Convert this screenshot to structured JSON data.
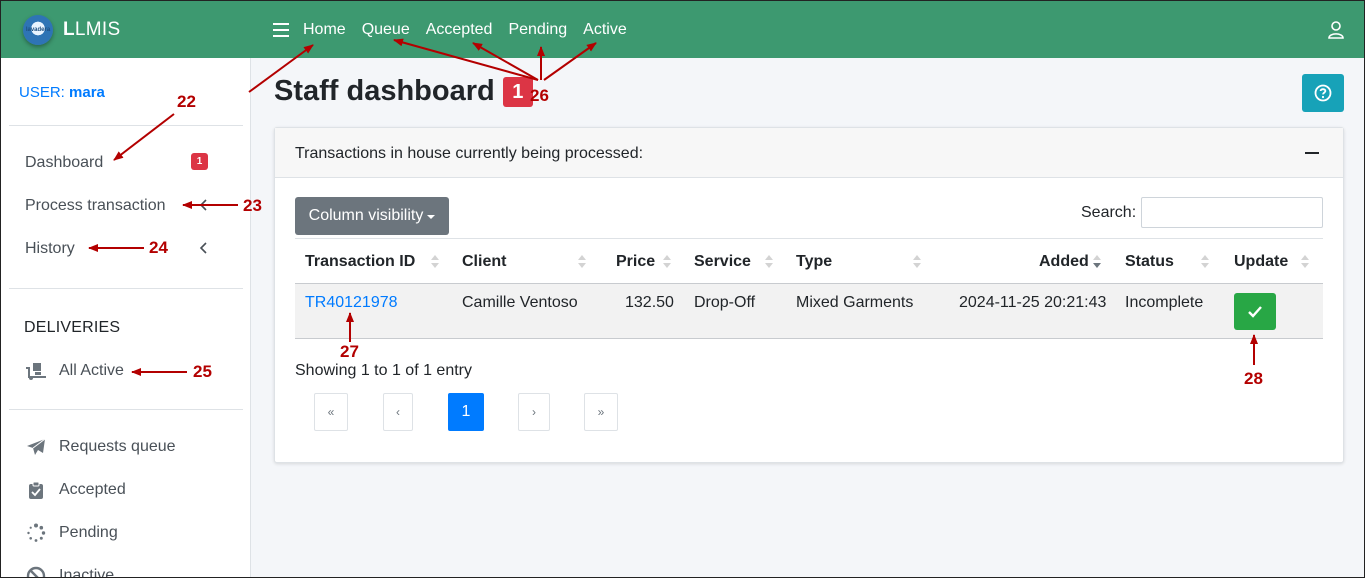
{
  "app": {
    "brand_rest": "LMIS",
    "brand_first": "L",
    "logo_text": "lavadera"
  },
  "topnav": {
    "links": [
      "Home",
      "Queue",
      "Accepted",
      "Pending",
      "Active"
    ]
  },
  "sidebar": {
    "user_label": "USER:",
    "user_name": "mara",
    "items": [
      {
        "label": "Dashboard",
        "badge": "1"
      },
      {
        "label": "Process transaction"
      },
      {
        "label": "History"
      }
    ],
    "deliveries_header": "DELIVERIES",
    "delivery_items": [
      {
        "label": "All Active",
        "icon": "truck-loading-icon"
      }
    ],
    "queue_items": [
      {
        "label": "Requests queue",
        "icon": "paper-plane-icon"
      },
      {
        "label": "Accepted",
        "icon": "clipboard-check-icon"
      },
      {
        "label": "Pending",
        "icon": "spinner-icon"
      },
      {
        "label": "Inactive",
        "icon": "ban-icon"
      }
    ]
  },
  "main": {
    "title": "Staff dashboard",
    "title_badge": "1",
    "card_title": "Transactions in house currently being processed:",
    "column_visibility": "Column visibility",
    "search_label": "Search:",
    "search_value": "",
    "columns": [
      "Transaction ID",
      "Client",
      "Price",
      "Service",
      "Type",
      "Added",
      "Status",
      "Update"
    ],
    "rows": [
      {
        "transaction_id": "TR40121978",
        "client": "Camille Ventoso",
        "price": "132.50",
        "service": "Drop-Off",
        "type": "Mixed Garments",
        "added": "2024-11-25 20:21:43",
        "status": "Incomplete"
      }
    ],
    "showing": "Showing 1 to 1 of 1 entry",
    "pagination": {
      "first": "«",
      "prev": "‹",
      "current": "1",
      "next": "›",
      "last": "»"
    }
  },
  "annotations": [
    "22",
    "23",
    "24",
    "25",
    "26",
    "27",
    "28"
  ],
  "colors": {
    "navbar": "#3d9970",
    "annotation": "#b30000",
    "badge": "#dc3545",
    "info": "#17a2b8",
    "success": "#28a745"
  }
}
